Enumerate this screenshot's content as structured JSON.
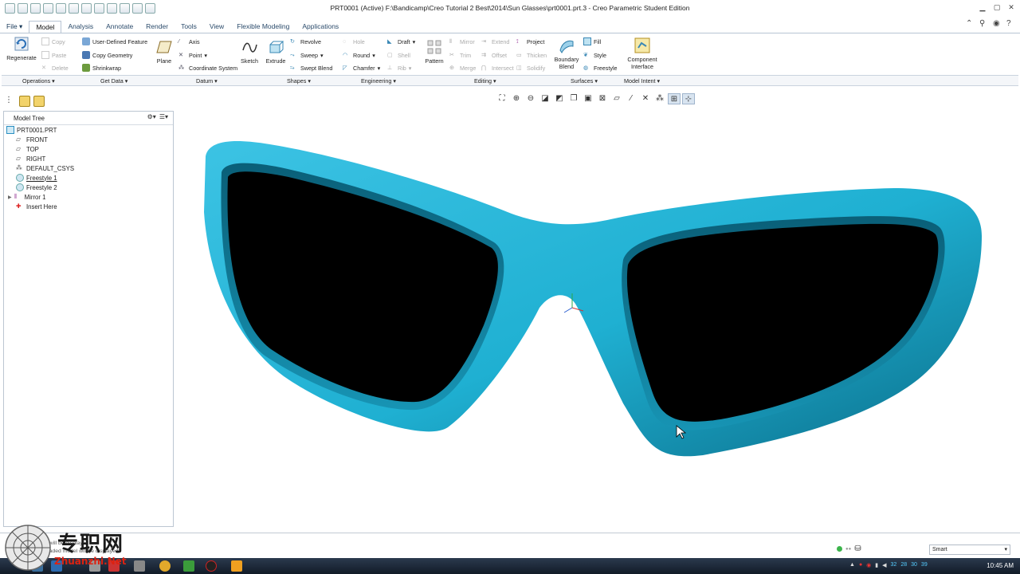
{
  "window": {
    "title": "PRT0001 (Active) F:\\Bandicamp\\Creo Tutorial 2 Best\\2014\\Sun Glasses\\prt0001.prt.3 - Creo Parametric Student Edition"
  },
  "tabs": [
    {
      "label": "File ▾"
    },
    {
      "label": "Model"
    },
    {
      "label": "Analysis"
    },
    {
      "label": "Annotate"
    },
    {
      "label": "Render"
    },
    {
      "label": "Tools"
    },
    {
      "label": "View"
    },
    {
      "label": "Flexible Modeling"
    },
    {
      "label": "Applications"
    }
  ],
  "ribbon": {
    "regenerate": "Regenerate",
    "copy": "Copy",
    "paste": "Paste",
    "delete": "Delete",
    "user_defined_feature": "User-Defined Feature",
    "copy_geometry": "Copy Geometry",
    "shrinkwrap": "Shrinkwrap",
    "plane": "Plane",
    "axis": "Axis",
    "point": "Point",
    "coordinate_system": "Coordinate System",
    "sketch": "Sketch",
    "extrude": "Extrude",
    "revolve": "Revolve",
    "sweep": "Sweep",
    "swept_blend": "Swept Blend",
    "hole": "Hole",
    "round": "Round",
    "chamfer": "Chamfer",
    "draft": "Draft",
    "shell": "Shell",
    "rib": "Rib",
    "pattern": "Pattern",
    "mirror": "Mirror",
    "trim": "Trim",
    "merge": "Merge",
    "extend": "Extend",
    "offset": "Offset",
    "intersect": "Intersect",
    "project": "Project",
    "thicken": "Thicken",
    "solidify": "Solidify",
    "boundary_blend_1": "Boundary",
    "boundary_blend_2": "Blend",
    "fill": "Fill",
    "style": "Style",
    "freestyle": "Freestyle",
    "component_interface_1": "Component",
    "component_interface_2": "Interface"
  },
  "groups": [
    {
      "label": "Operations ▾"
    },
    {
      "label": "Get Data ▾"
    },
    {
      "label": "Datum ▾"
    },
    {
      "label": "Shapes ▾"
    },
    {
      "label": "Engineering ▾"
    },
    {
      "label": "Editing ▾"
    },
    {
      "label": "Surfaces ▾"
    },
    {
      "label": "Model Intent ▾"
    }
  ],
  "model_tree": {
    "header": "Model Tree",
    "items": [
      {
        "label": "PRT0001.PRT"
      },
      {
        "label": "FRONT"
      },
      {
        "label": "TOP"
      },
      {
        "label": "RIGHT"
      },
      {
        "label": "DEFAULT_CSYS"
      },
      {
        "label": "Freestyle 1"
      },
      {
        "label": "Freestyle 2"
      },
      {
        "label": "Mirror 1"
      },
      {
        "label": "Insert Here"
      }
    ]
  },
  "status": {
    "message1": "...will be displayed",
    "message2": "...aded model will be displayed",
    "selection_filter": "Smart"
  },
  "taskbar": {
    "clock": "10:45 AM",
    "tray_numbers": [
      "32",
      "28",
      "30",
      "39"
    ]
  },
  "watermark": {
    "chinese": "专职网",
    "url": "Zhuanzhi.Net"
  },
  "colors": {
    "glasses_frame": "#1fb0d2",
    "lens": "#000000",
    "accent": "#b7c4d3"
  }
}
